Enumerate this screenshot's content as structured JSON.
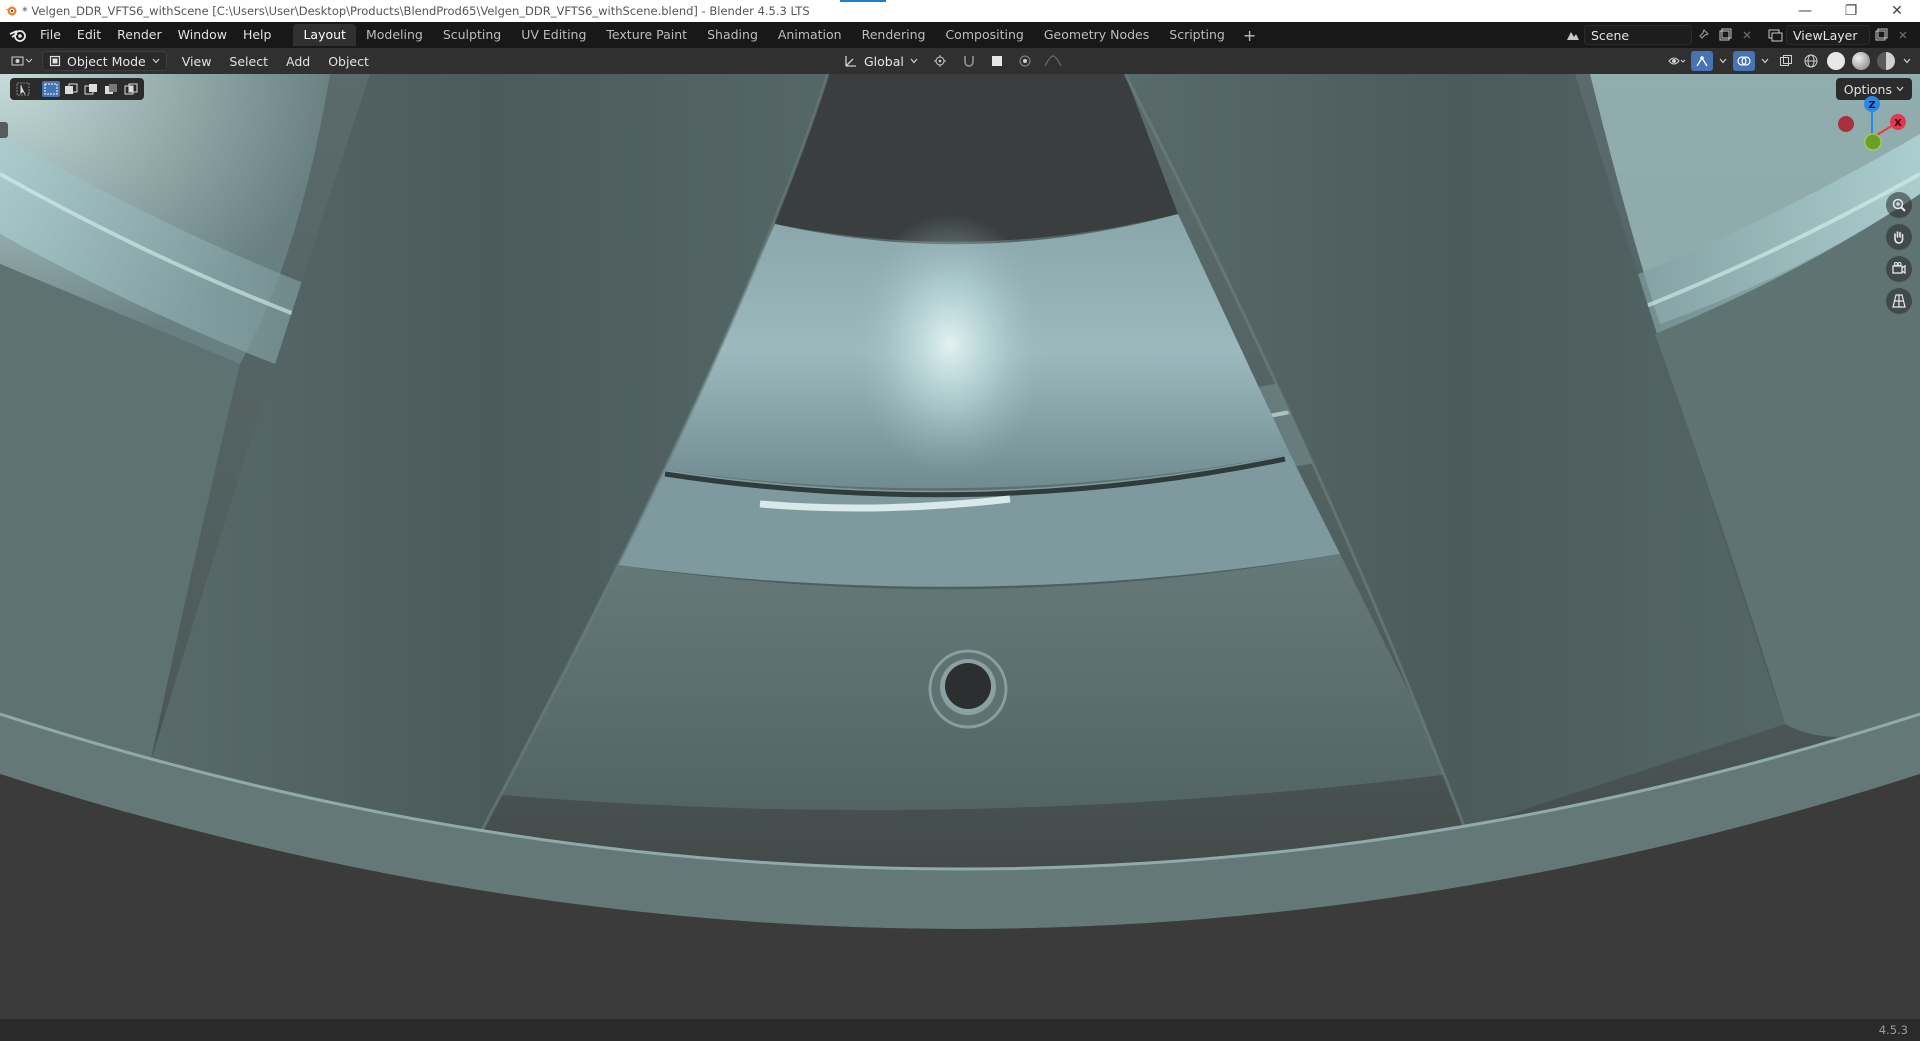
{
  "window": {
    "title": "* Velgen_DDR_VFTS6_withScene [C:\\Users\\User\\Desktop\\Products\\BlendProd65\\Velgen_DDR_VFTS6_withScene.blend] - Blender 4.5.3 LTS",
    "minimize": "—",
    "restore": "❐",
    "close": "✕"
  },
  "menubar": {
    "items": [
      "File",
      "Edit",
      "Render",
      "Window",
      "Help"
    ]
  },
  "workspaces": {
    "tabs": [
      "Layout",
      "Modeling",
      "Sculpting",
      "UV Editing",
      "Texture Paint",
      "Shading",
      "Animation",
      "Rendering",
      "Compositing",
      "Geometry Nodes",
      "Scripting"
    ],
    "active": "Layout",
    "add": "+"
  },
  "scene": {
    "name": "Scene",
    "view_layer": "ViewLayer"
  },
  "viewport_header": {
    "mode": "Object Mode",
    "menus": [
      "View",
      "Select",
      "Add",
      "Object"
    ],
    "transform_orientation": "Global"
  },
  "viewport": {
    "options_label": "Options",
    "gizmo_axes": {
      "z": "Z",
      "x": "X"
    }
  },
  "statusbar": {
    "version": "4.5.3"
  },
  "colors": {
    "accent": "#4772b3",
    "axis_x": "#e0394f",
    "axis_y": "#8bc72a",
    "axis_z": "#2e86e6"
  }
}
